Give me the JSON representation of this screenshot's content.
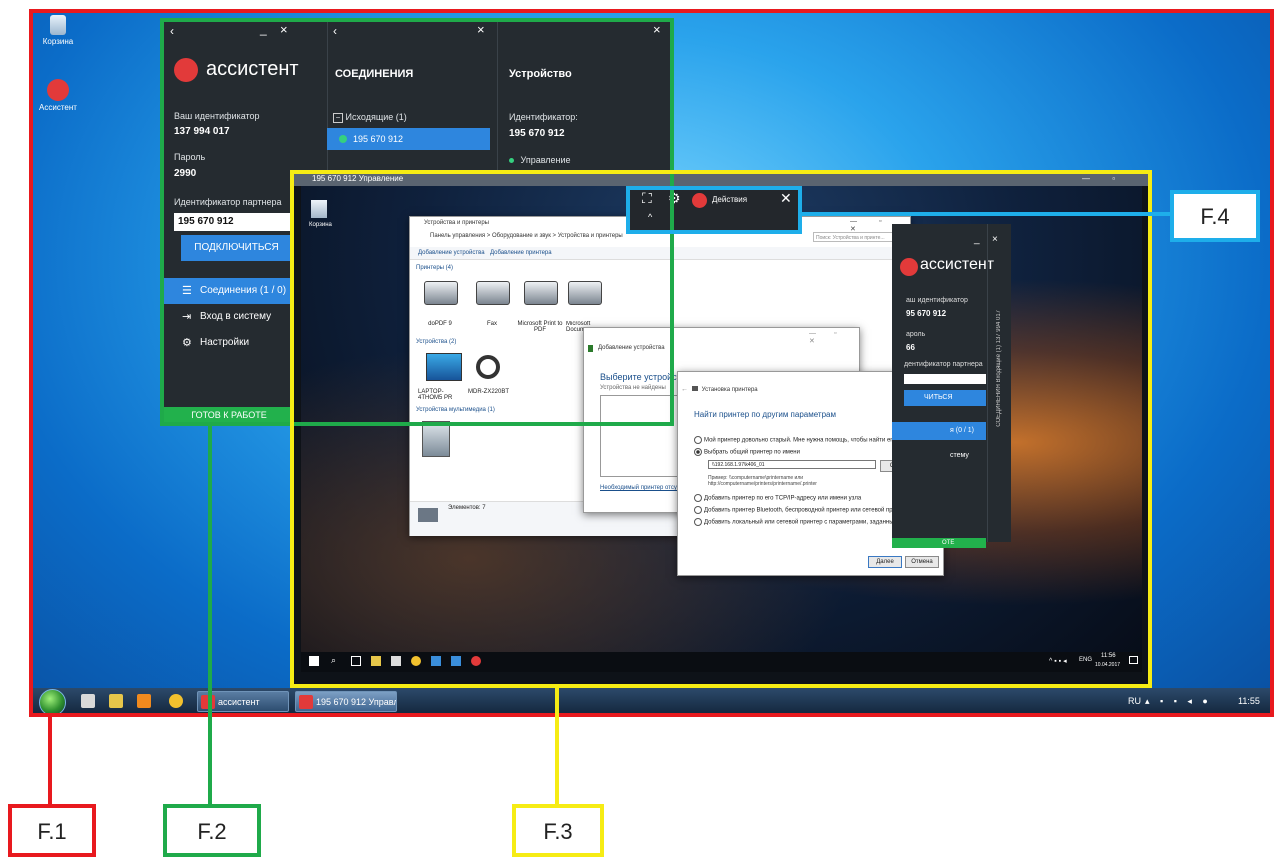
{
  "desktop": {
    "icons": [
      {
        "label": "Корзина",
        "icon": "recycle-bin-icon"
      },
      {
        "label": "Ассистент",
        "icon": "assistant-app-icon"
      }
    ],
    "taskbar": {
      "buttons": [
        {
          "label": "ассистент",
          "icon": "assistant-icon"
        },
        {
          "label": "195 670 912 Управле...",
          "icon": "assistant-icon"
        }
      ],
      "tray": {
        "lang": "RU",
        "time": "11:55"
      }
    }
  },
  "assistant": {
    "brand": "ассистент",
    "your_id_label": "Ваш идентификатор",
    "your_id": "137 994 017",
    "password_label": "Пароль",
    "password": "2990",
    "partner_label": "Идентификатор партнера",
    "partner_value": "195 670 912",
    "connect_button": "ПОДКЛЮЧИТЬСЯ",
    "menu": [
      {
        "label": "Соединения (1 / 0)",
        "icon": "sliders-icon"
      },
      {
        "label": "Вход в систему",
        "icon": "login-icon"
      },
      {
        "label": "Настройки",
        "icon": "gear-icon"
      }
    ],
    "status": "ГОТОВ К РАБОТЕ",
    "connections_title": "СОЕДИНЕНИЯ",
    "outgoing_label": "Исходящие (1)",
    "outgoing_item": "195 670 912",
    "device_title": "Устройство",
    "device_id_label": "Идентификатор:",
    "device_id": "195 670 912",
    "device_control": "Управление"
  },
  "remote": {
    "title": "195 670 912 Управление",
    "recycle_label": "Корзина",
    "devices_window": {
      "title": "Устройства и принтеры",
      "address": "Панель управления  >  Оборудование и звук  >  Устройства и принтеры",
      "search_placeholder": "Поиск: Устройства и принте...",
      "toolbar": [
        "Добавление устройства",
        "Добавление принтера"
      ],
      "printers_group": "Принтеры (4)",
      "printers": [
        "doPDF 9",
        "Fax",
        "Microsoft Print to PDF",
        "Microsoft Docume"
      ],
      "devices_group": "Устройства (2)",
      "devices": [
        "LAPTOP-4THOM5 PR",
        "MDR-ZX220BT"
      ],
      "multimedia_group": "Устройства мультимедиа (1)",
      "elements": "Элементов: 7"
    },
    "add_device_window": {
      "title": "Добавление устройства",
      "heading": "Выберите устройство",
      "subheading": "Устройства не найдены",
      "link": "Необходимый принтер отсутст..."
    },
    "printer_dialog": {
      "title": "Установка принтера",
      "heading": "Найти принтер по другим параметрам",
      "options": [
        "Мой принтер довольно старый. Мне нужна помощь, чтобы найти его.",
        "Выбрать общий принтер по имени",
        "Добавить принтер по его TCP/IP-адресу или имени узла",
        "Добавить принтер Bluetooth, беспроводной принтер или сетевой принтер",
        "Добавить локальный или сетевой принтер с параметрами, заданными вручную"
      ],
      "selected_index": 1,
      "path_value": "\\\\192.168.1.97\\k406_01",
      "browse_button": "Обзор...",
      "example": "Пример: \\\\computername\\printername или http://computername/printers/printername/.printer",
      "next_button": "Далее",
      "cancel_button": "Отмена"
    },
    "inner_assistant": {
      "brand": "ассистент",
      "id_label": "аш идентификатор",
      "id": "95 670 912",
      "password_label": "ароль",
      "password": "66",
      "partner_label": "дентификатор партнера",
      "connect": "ЧИТЬСЯ",
      "connections": "я (0 / 1)",
      "menu_fragment": "стему",
      "status": "ОТЕ",
      "vertical_text": "СОЕДИНЕНИЯ  Входящие (1)   137 994 017"
    },
    "taskbar": {
      "lang": "ENG",
      "time": "11:56",
      "date": "10.04.2017"
    }
  },
  "actions_bar": {
    "label": "Действия"
  },
  "callouts": [
    {
      "label": "F.1",
      "color": "#e8191e"
    },
    {
      "label": "F.2",
      "color": "#1faa4a"
    },
    {
      "label": "F.3",
      "color": "#f6ec14"
    },
    {
      "label": "F.4",
      "color": "#1eaeea"
    }
  ]
}
